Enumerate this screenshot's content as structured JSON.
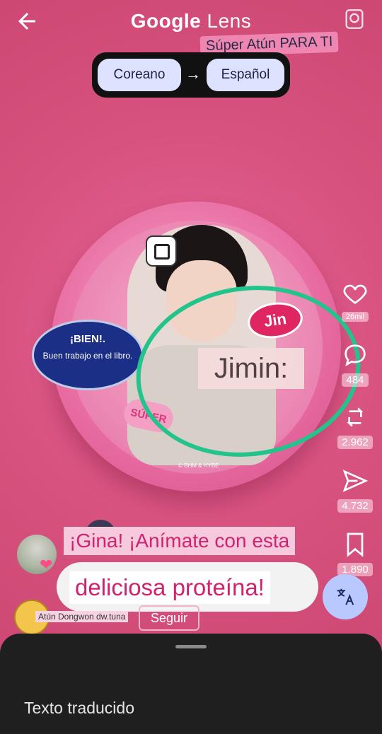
{
  "app": {
    "title_main": "Google",
    "title_sub": "Lens"
  },
  "language": {
    "source": "Coreano",
    "target": "Español",
    "arrow": "→"
  },
  "stickers": {
    "top_banner": "Súper Atún PARA TI",
    "bien_title": "¡BIEN!.",
    "bien_subtitle": "Buen trabajo en el libro.",
    "jin_tag": "Jin",
    "jimin_label": "Jimin:",
    "super_label": "SÚPER",
    "copyright": "© BHM & HYBE"
  },
  "actions": {
    "likes": "26mil",
    "comments": "484",
    "reposts": "2.962",
    "shares": "4.732",
    "saves": "1.890"
  },
  "captions": {
    "line1": "¡Gina! ¡Anímate con esta",
    "line2": "deliciosa proteína!"
  },
  "account": {
    "name": "Atún Dongwon dw.tuna",
    "follow_label": "Seguir"
  },
  "sheet": {
    "title": "Texto traducido"
  },
  "icons": [
    "back-arrow-icon",
    "image-search-icon",
    "heart-icon",
    "comment-icon",
    "repost-icon",
    "send-icon",
    "bookmark-icon",
    "translate-icon"
  ],
  "colors": {
    "accent_green": "#22c48b",
    "caption_pink": "#d0236f",
    "fab": "#b9c8ff"
  }
}
